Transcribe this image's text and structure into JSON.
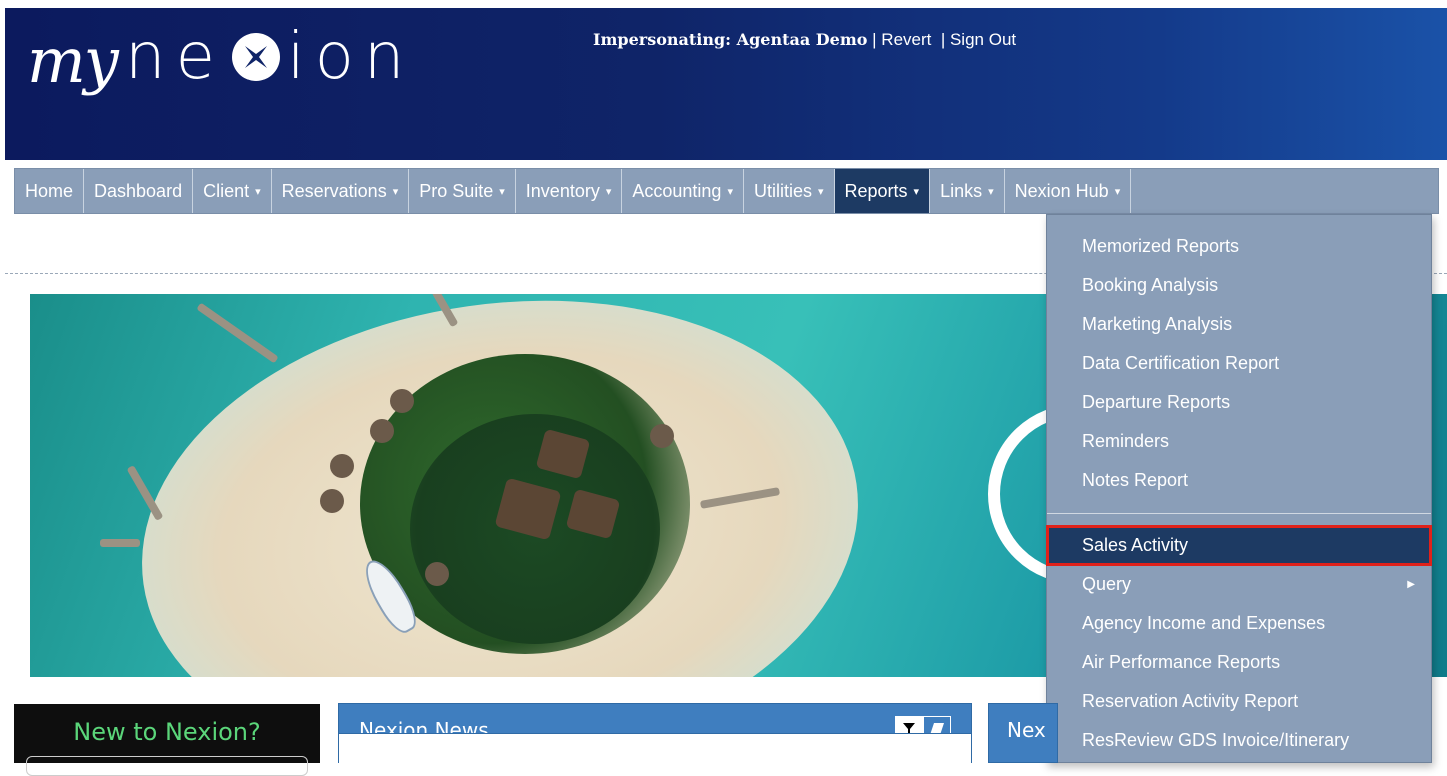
{
  "header": {
    "logo_my": "my",
    "logo_nexion_left": "ne",
    "logo_nexion_right": "ion",
    "impersonating": "Impersonating: Agentaa Demo",
    "separator": " | ",
    "revert": "Revert",
    "signout_sep": "  | ",
    "signout": "Sign Out"
  },
  "nav": {
    "items": [
      {
        "label": "Home"
      },
      {
        "label": "Dashboard"
      },
      {
        "label": "Client"
      },
      {
        "label": "Reservations"
      },
      {
        "label": "Pro Suite"
      },
      {
        "label": "Inventory"
      },
      {
        "label": "Accounting"
      },
      {
        "label": "Utilities"
      },
      {
        "label": "Reports"
      },
      {
        "label": "Links"
      },
      {
        "label": "Nexion Hub"
      }
    ],
    "caret": "▾"
  },
  "reports_menu": {
    "items": [
      "Memorized Reports",
      "Booking Analysis",
      "Marketing Analysis",
      "Data Certification Report",
      "Departure Reports",
      "Reminders",
      "Notes Report",
      "Sales Activity",
      "Query",
      "Agency Income and Expenses",
      "Air Performance Reports",
      "Reservation Activity Report",
      "ResReview GDS Invoice/Itinerary"
    ],
    "submenu_arrow": "▶"
  },
  "panels": {
    "new_to_nexion": "New to Nexion?",
    "news_title": "Nexion News",
    "nex_title": "Nex"
  },
  "colors": {
    "nav_bg": "#8a9eb8",
    "active_bg": "#1d3a63",
    "highlight": "#e0211a",
    "header_bg": "#0f2468",
    "news_bg": "#3f7ebf"
  }
}
